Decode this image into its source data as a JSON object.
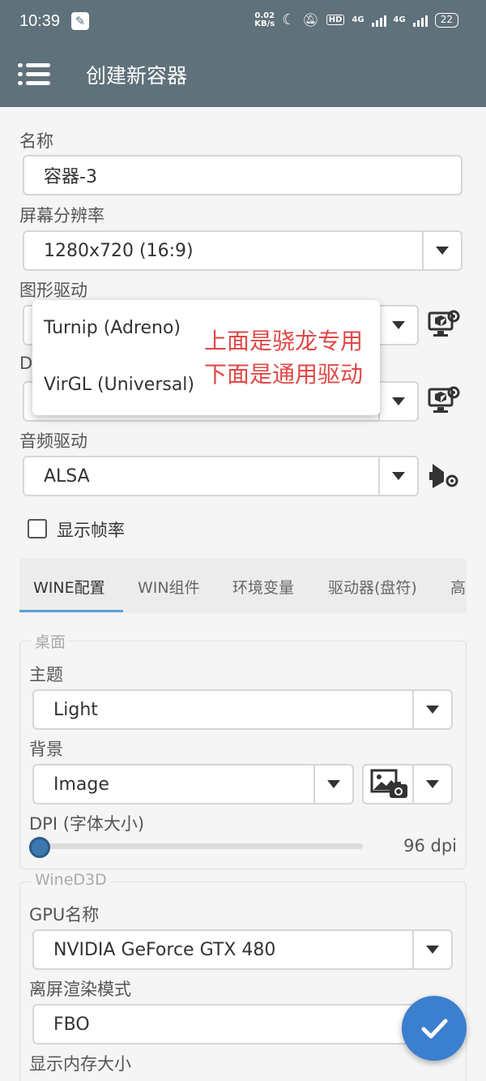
{
  "status_bar": {
    "time": "10:39",
    "net_speed_value": "0.02",
    "net_speed_unit": "KB/s",
    "hd_badge": "HD",
    "sim1_type": "4G",
    "sim2_type": "4G",
    "battery": "22"
  },
  "app_bar": {
    "title": "创建新容器"
  },
  "form": {
    "name_label": "名称",
    "name_value": "容器-3",
    "resolution_label": "屏幕分辨率",
    "resolution_value": "1280x720 (16:9)",
    "graphics_label": "图形驱动",
    "dx_label_partial": "D",
    "audio_label": "音频驱动",
    "audio_value": "ALSA",
    "show_fps_label": "显示帧率",
    "show_fps_checked": false
  },
  "dropdown": {
    "options": [
      "Turnip (Adreno)",
      "VirGL (Universal)"
    ]
  },
  "annotation": {
    "line1": "上面是骁龙专用",
    "line2": "下面是通用驱动"
  },
  "tabs": [
    "WINE配置",
    "WIN组件",
    "环境变量",
    "驱动器(盘符)",
    "高"
  ],
  "active_tab": 0,
  "desktop_group": {
    "title": "桌面",
    "theme_label": "主题",
    "theme_value": "Light",
    "background_label": "背景",
    "background_value": "Image",
    "dpi_label": "DPI (字体大小)",
    "dpi_value": "96 dpi",
    "dpi_slider_fraction": 0.0
  },
  "wined3d_group": {
    "title": "WineD3D",
    "gpu_label": "GPU名称",
    "gpu_value": "NVIDIA GeForce GTX 480",
    "offscreen_label": "离屏渲染模式",
    "offscreen_value": "FBO",
    "vram_label": "显示内存大小"
  },
  "colors": {
    "app_bar": "#5f717a",
    "accent": "#3b7fcf",
    "annotation": "#e04848"
  },
  "icons": {
    "menu": "menu-icon",
    "settings_driver": "monitor-gear-icon",
    "audio_settings": "speaker-gear-icon",
    "image_picker": "image-camera-icon",
    "confirm": "check-icon"
  }
}
